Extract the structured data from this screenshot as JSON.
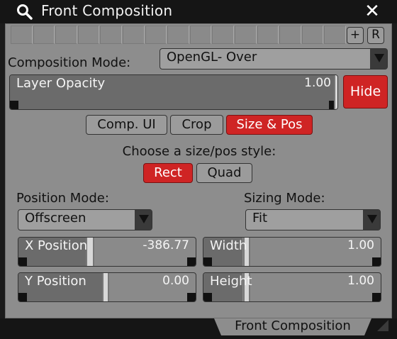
{
  "window": {
    "title": "Front Composition",
    "close_glyph": "✕"
  },
  "strip": {
    "plus_label": "+",
    "reset_label": "R"
  },
  "composition": {
    "label": "Composition Mode:",
    "value": "OpenGL- Over"
  },
  "opacity": {
    "label": "Layer Opacity",
    "value": "1.00",
    "hide_label": "Hide"
  },
  "tabs": {
    "comp_ui": "Comp. UI",
    "crop": "Crop",
    "size_pos": "Size & Pos",
    "active": "Size & Pos"
  },
  "style": {
    "prompt": "Choose a size/pos style:",
    "rect": "Rect",
    "quad": "Quad",
    "active": "Rect"
  },
  "position": {
    "label": "Position Mode:",
    "value": "Offscreen"
  },
  "sizing": {
    "label": "Sizing Mode:",
    "value": "Fit"
  },
  "fields": {
    "x_position": {
      "label": "X Position",
      "value": "-386.77"
    },
    "y_position": {
      "label": "Y Position",
      "value": "0.00"
    },
    "width": {
      "label": "Width",
      "value": "1.00"
    },
    "height": {
      "label": "Height",
      "value": "1.00"
    }
  },
  "bottom_tab": {
    "label": "Front Composition"
  },
  "colors": {
    "accent_red": "#cf2424",
    "panel": "#8d8d8d",
    "titlebar": "#151515"
  },
  "icons": {
    "search": "search-icon",
    "close": "close-icon",
    "resize": "resize-corner-icon"
  }
}
